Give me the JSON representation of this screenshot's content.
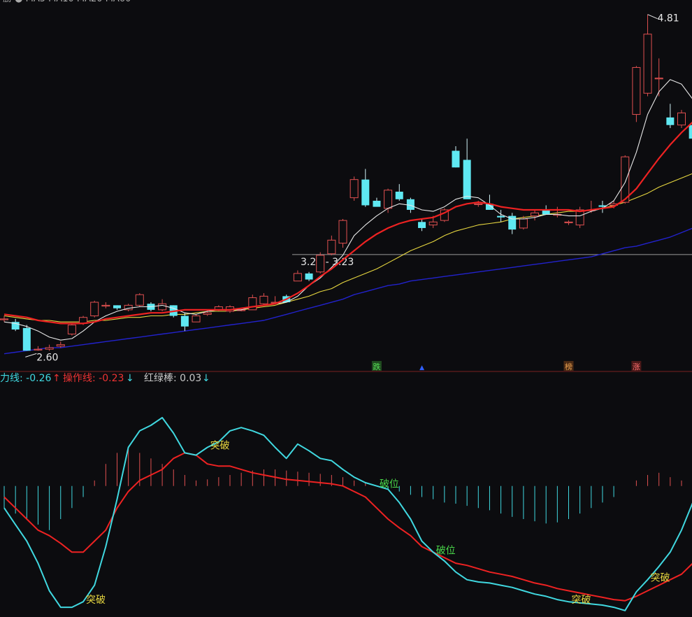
{
  "colors": {
    "background": "#0c0c0f",
    "candle_up": "#e05050",
    "candle_down": "#5fe8f2",
    "ma_white": "#e8e8e8",
    "ma_red": "#ee2222",
    "ma_yellow": "#e8d840",
    "ma_blue": "#2222cc",
    "power_line": "#40d8e0",
    "operation_line": "#ee2222",
    "divider": "#7a1f1f"
  },
  "legend": {
    "power_line": "力线: -0.26",
    "power_arrow": "↑",
    "operation_line": "操作线: -0.23",
    "operation_arrow": "↓",
    "red_green_bar": "红绿棒: 0.03",
    "red_green_arrow": "↓"
  },
  "chart_data": [
    {
      "type": "candlestick",
      "ylim": [
        2.55,
        4.85
      ],
      "max_label": "4.81",
      "min_label": "2.60",
      "price_line": {
        "value": 3.225,
        "label": "3.22 - 3.23"
      },
      "candles": [
        [
          2.8,
          2.8,
          2.82,
          2.78
        ],
        [
          2.78,
          2.73,
          2.8,
          2.72
        ],
        [
          2.74,
          2.59,
          2.76,
          2.59
        ],
        [
          2.6,
          2.6,
          2.62,
          2.59
        ],
        [
          2.6,
          2.61,
          2.63,
          2.59
        ],
        [
          2.62,
          2.63,
          2.65,
          2.61
        ],
        [
          2.7,
          2.76,
          2.77,
          2.69
        ],
        [
          2.77,
          2.81,
          2.82,
          2.76
        ],
        [
          2.82,
          2.91,
          2.92,
          2.81
        ],
        [
          2.89,
          2.89,
          2.91,
          2.87
        ],
        [
          2.89,
          2.87,
          2.89,
          2.86
        ],
        [
          2.86,
          2.89,
          2.9,
          2.85
        ],
        [
          2.89,
          2.96,
          2.97,
          2.88
        ],
        [
          2.9,
          2.86,
          2.91,
          2.85
        ],
        [
          2.86,
          2.9,
          2.93,
          2.85
        ],
        [
          2.89,
          2.82,
          2.89,
          2.81
        ],
        [
          2.82,
          2.75,
          2.84,
          2.72
        ],
        [
          2.78,
          2.82,
          2.83,
          2.78
        ],
        [
          2.83,
          2.84,
          2.86,
          2.82
        ],
        [
          2.86,
          2.88,
          2.89,
          2.85
        ],
        [
          2.85,
          2.88,
          2.89,
          2.84
        ],
        [
          2.86,
          2.86,
          2.87,
          2.85
        ],
        [
          2.86,
          2.94,
          2.96,
          2.86
        ],
        [
          2.9,
          2.95,
          2.97,
          2.89
        ],
        [
          2.91,
          2.91,
          2.95,
          2.9
        ],
        [
          2.95,
          2.91,
          2.96,
          2.91
        ],
        [
          3.05,
          3.1,
          3.12,
          3.05
        ],
        [
          3.1,
          3.06,
          3.11,
          3.05
        ],
        [
          3.11,
          3.22,
          3.24,
          3.1
        ],
        [
          3.23,
          3.32,
          3.35,
          3.22
        ],
        [
          3.3,
          3.45,
          3.46,
          3.27
        ],
        [
          3.6,
          3.72,
          3.74,
          3.58
        ],
        [
          3.72,
          3.55,
          3.79,
          3.54
        ],
        [
          3.58,
          3.54,
          3.6,
          3.55
        ],
        [
          3.53,
          3.65,
          3.66,
          3.5
        ],
        [
          3.64,
          3.59,
          3.69,
          3.58
        ],
        [
          3.59,
          3.52,
          3.6,
          3.5
        ],
        [
          3.44,
          3.4,
          3.46,
          3.38
        ],
        [
          3.42,
          3.44,
          3.48,
          3.4
        ],
        [
          3.45,
          3.52,
          3.53,
          3.44
        ],
        [
          3.91,
          3.8,
          3.94,
          3.8
        ],
        [
          3.85,
          3.59,
          3.99,
          3.6
        ],
        [
          3.56,
          3.56,
          3.58,
          3.54
        ],
        [
          3.56,
          3.52,
          3.62,
          3.52
        ],
        [
          3.48,
          3.47,
          3.52,
          3.44
        ],
        [
          3.48,
          3.39,
          3.5,
          3.36
        ],
        [
          3.4,
          3.46,
          3.48,
          3.39
        ],
        [
          3.48,
          3.5,
          3.52,
          3.45
        ],
        [
          3.52,
          3.49,
          3.55,
          3.49
        ],
        [
          3.49,
          3.49,
          3.54,
          3.47
        ],
        [
          3.44,
          3.44,
          3.45,
          3.42
        ],
        [
          3.42,
          3.52,
          3.54,
          3.4
        ],
        [
          3.52,
          3.52,
          3.58,
          3.5
        ],
        [
          3.55,
          3.54,
          3.58,
          3.5
        ],
        [
          3.55,
          3.56,
          3.58,
          3.53
        ],
        [
          3.57,
          3.87,
          3.88,
          3.56
        ],
        [
          4.15,
          4.46,
          4.47,
          4.1
        ],
        [
          4.29,
          4.68,
          4.81,
          4.27
        ],
        [
          4.39,
          4.39,
          4.52,
          4.27
        ],
        [
          4.13,
          4.08,
          4.22,
          4.06
        ],
        [
          4.08,
          4.16,
          4.18,
          4.06
        ],
        [
          4.08,
          3.99,
          4.1,
          3.97
        ],
        [
          4.0,
          4.05,
          4.08,
          3.95
        ],
        [
          4.09,
          4.5,
          4.52,
          4.09
        ],
        [
          4.67,
          4.6,
          4.7,
          4.43
        ],
        [
          4.56,
          4.56,
          4.63,
          4.5
        ],
        [
          4.61,
          4.4,
          4.62,
          4.33
        ],
        [
          4.39,
          4.48,
          4.5,
          4.33
        ]
      ],
      "ma_white": [
        2.78,
        2.77,
        2.75,
        2.72,
        2.68,
        2.66,
        2.67,
        2.72,
        2.78,
        2.82,
        2.85,
        2.87,
        2.88,
        2.88,
        2.89,
        2.87,
        2.84,
        2.83,
        2.85,
        2.86,
        2.86,
        2.86,
        2.88,
        2.89,
        2.9,
        2.91,
        2.95,
        3.02,
        3.07,
        3.14,
        3.22,
        3.35,
        3.42,
        3.48,
        3.53,
        3.56,
        3.55,
        3.52,
        3.51,
        3.54,
        3.59,
        3.61,
        3.6,
        3.55,
        3.49,
        3.46,
        3.46,
        3.47,
        3.49,
        3.49,
        3.48,
        3.48,
        3.51,
        3.53,
        3.58,
        3.7,
        3.9,
        4.15,
        4.3,
        4.38,
        4.35,
        4.25,
        4.16,
        4.2,
        4.36,
        4.49,
        4.51,
        4.48
      ],
      "ma_red": [
        2.83,
        2.82,
        2.81,
        2.79,
        2.78,
        2.77,
        2.77,
        2.77,
        2.78,
        2.8,
        2.81,
        2.82,
        2.83,
        2.84,
        2.84,
        2.85,
        2.86,
        2.86,
        2.86,
        2.86,
        2.86,
        2.87,
        2.88,
        2.89,
        2.9,
        2.93,
        2.97,
        3.02,
        3.08,
        3.13,
        3.19,
        3.25,
        3.31,
        3.36,
        3.4,
        3.43,
        3.45,
        3.46,
        3.47,
        3.5,
        3.54,
        3.56,
        3.57,
        3.56,
        3.54,
        3.53,
        3.52,
        3.52,
        3.52,
        3.52,
        3.52,
        3.51,
        3.52,
        3.53,
        3.54,
        3.59,
        3.66,
        3.76,
        3.86,
        3.95,
        4.03,
        4.1,
        4.16,
        4.26,
        4.36,
        4.44,
        4.45,
        4.43
      ],
      "ma_yellow": [
        2.82,
        2.81,
        2.8,
        2.79,
        2.79,
        2.78,
        2.78,
        2.78,
        2.79,
        2.79,
        2.8,
        2.81,
        2.81,
        2.82,
        2.82,
        2.83,
        2.83,
        2.84,
        2.85,
        2.85,
        2.85,
        2.86,
        2.87,
        2.88,
        2.89,
        2.91,
        2.93,
        2.95,
        2.98,
        3.0,
        3.04,
        3.07,
        3.1,
        3.13,
        3.17,
        3.21,
        3.25,
        3.28,
        3.31,
        3.35,
        3.38,
        3.4,
        3.42,
        3.43,
        3.44,
        3.46,
        3.47,
        3.48,
        3.49,
        3.5,
        3.51,
        3.51,
        3.52,
        3.53,
        3.55,
        3.57,
        3.6,
        3.63,
        3.67,
        3.7,
        3.73,
        3.76,
        3.8,
        3.84,
        3.88,
        3.93,
        3.98,
        4.01
      ],
      "ma_blue": [
        2.57,
        2.58,
        2.59,
        2.6,
        2.61,
        2.61,
        2.62,
        2.63,
        2.64,
        2.65,
        2.66,
        2.67,
        2.68,
        2.69,
        2.7,
        2.71,
        2.72,
        2.73,
        2.74,
        2.75,
        2.76,
        2.77,
        2.78,
        2.79,
        2.81,
        2.83,
        2.85,
        2.87,
        2.89,
        2.91,
        2.93,
        2.96,
        2.98,
        3.0,
        3.02,
        3.03,
        3.05,
        3.06,
        3.07,
        3.08,
        3.09,
        3.1,
        3.11,
        3.12,
        3.13,
        3.14,
        3.15,
        3.16,
        3.17,
        3.18,
        3.19,
        3.2,
        3.21,
        3.23,
        3.25,
        3.27,
        3.28,
        3.3,
        3.32,
        3.34,
        3.37,
        3.4,
        3.42,
        3.45,
        3.49,
        3.52,
        3.56,
        3.59
      ]
    },
    {
      "type": "line",
      "ylim": [
        -1.15,
        0.88
      ],
      "series": [
        {
          "name": "力线",
          "values": [
            -0.2,
            -0.35,
            -0.5,
            -0.7,
            -0.95,
            -1.1,
            -1.1,
            -1.05,
            -0.9,
            -0.55,
            -0.12,
            0.35,
            0.5,
            0.55,
            0.62,
            0.48,
            0.3,
            0.28,
            0.35,
            0.4,
            0.5,
            0.53,
            0.5,
            0.46,
            0.35,
            0.25,
            0.38,
            0.32,
            0.25,
            0.23,
            0.15,
            0.08,
            0.03,
            0.0,
            -0.03,
            -0.15,
            -0.3,
            -0.5,
            -0.6,
            -0.68,
            -0.78,
            -0.85,
            -0.87,
            -0.88,
            -0.9,
            -0.92,
            -0.95,
            -0.98,
            -1.0,
            -1.03,
            -1.05,
            -1.06,
            -1.07,
            -1.08,
            -1.1,
            -1.13,
            -0.96,
            -0.85,
            -0.73,
            -0.6,
            -0.4,
            -0.15,
            0.12,
            0.3,
            0.38,
            0.42,
            0.45,
            0.43
          ]
        },
        {
          "name": "操作线",
          "values": [
            -0.1,
            -0.2,
            -0.3,
            -0.4,
            -0.45,
            -0.52,
            -0.6,
            -0.6,
            -0.5,
            -0.4,
            -0.2,
            -0.05,
            0.05,
            0.1,
            0.15,
            0.25,
            0.3,
            0.28,
            0.2,
            0.18,
            0.18,
            0.15,
            0.12,
            0.1,
            0.08,
            0.06,
            0.05,
            0.04,
            0.03,
            0.02,
            0.0,
            -0.05,
            -0.1,
            -0.2,
            -0.3,
            -0.38,
            -0.45,
            -0.55,
            -0.6,
            -0.65,
            -0.7,
            -0.72,
            -0.75,
            -0.78,
            -0.8,
            -0.82,
            -0.85,
            -0.88,
            -0.9,
            -0.93,
            -0.95,
            -0.97,
            -0.99,
            -1.01,
            -1.03,
            -1.04,
            -1.0,
            -0.95,
            -0.9,
            -0.85,
            -0.8,
            -0.7,
            -0.5,
            -0.4,
            -0.3,
            -0.25,
            -0.24,
            -0.23
          ]
        }
      ],
      "bars": [
        -0.2,
        -0.25,
        -0.3,
        -0.35,
        -0.4,
        -0.3,
        -0.2,
        -0.1,
        0.05,
        0.2,
        0.3,
        0.35,
        0.3,
        0.25,
        0.2,
        0.15,
        0.1,
        0.05,
        0.06,
        0.08,
        0.1,
        0.12,
        0.14,
        0.15,
        0.15,
        0.14,
        0.13,
        0.12,
        0.11,
        0.1,
        0.08,
        0.05,
        0.03,
        0.0,
        -0.03,
        -0.05,
        -0.08,
        -0.1,
        -0.12,
        -0.15,
        -0.16,
        -0.18,
        -0.2,
        -0.22,
        -0.25,
        -0.28,
        -0.3,
        -0.32,
        -0.34,
        -0.33,
        -0.3,
        -0.25,
        -0.2,
        -0.15,
        -0.1,
        0.0,
        0.05,
        0.1,
        0.12,
        0.08,
        0.05,
        0.03,
        0.0,
        0.02,
        0.05,
        0.08,
        0.1,
        0.03
      ],
      "annotations": [
        {
          "text": "突破",
          "x": 7,
          "color": "#e8d840"
        },
        {
          "text": "突破",
          "x": 18,
          "color": "#e8d840"
        },
        {
          "text": "破位",
          "x": 33,
          "color": "#4ad84a"
        },
        {
          "text": "破位",
          "x": 38,
          "color": "#4ad84a"
        },
        {
          "text": "突破",
          "x": 50,
          "color": "#e8d840"
        },
        {
          "text": "突破",
          "x": 57,
          "color": "#e8d840"
        }
      ]
    }
  ],
  "signals": [
    {
      "text": "跌",
      "x": 33,
      "bg": "#1f4a1f",
      "fg": "#58e058"
    },
    {
      "text": "▲",
      "x": 37,
      "bg": "none",
      "fg": "#3060ff"
    },
    {
      "text": "榜",
      "x": 50,
      "bg": "#4a2a14",
      "fg": "#e8a050"
    },
    {
      "text": "涨",
      "x": 56,
      "bg": "#4a1818",
      "fg": "#ff7070"
    }
  ]
}
